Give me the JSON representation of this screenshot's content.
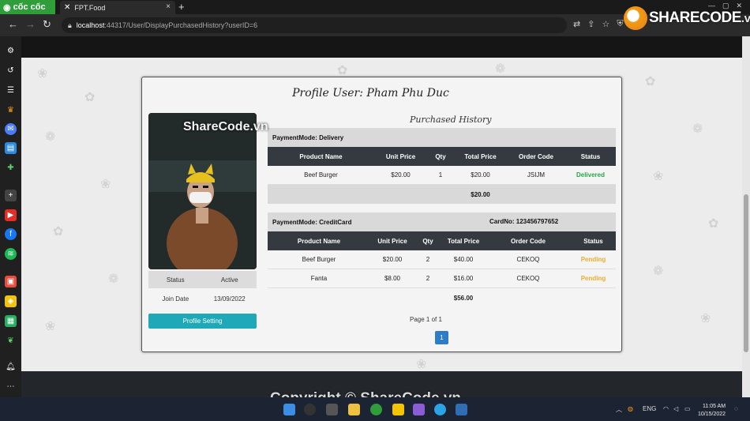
{
  "browser": {
    "brand": "cốc cốc",
    "tab_title": "FPT.Food",
    "url_host": "localhost",
    "url_path": ":44317/User/DisplayPurchasedHistory?userID=6"
  },
  "profile": {
    "title": "Profile User: Pham Phu Duc",
    "status_label": "Status",
    "status_value": "Active",
    "join_label": "Join Date",
    "join_value": "13/09/2022",
    "settings_button": "Profile Setting"
  },
  "history": {
    "title": "Purchased History",
    "orders": [
      {
        "payment_mode": "PaymentMode: Delivery",
        "card_no": "",
        "headers": [
          "Product Name",
          "Unit Price",
          "Qty",
          "Total Price",
          "Order Code",
          "Status"
        ],
        "items": [
          {
            "name": "Beef Burger",
            "unit_price": "$20.00",
            "qty": "1",
            "total": "$20.00",
            "code": "JSIJM",
            "status": "Delivered"
          }
        ],
        "total": "$20.00"
      },
      {
        "payment_mode": "PaymentMode: CreditCard",
        "card_no": "CardNo: 123456797652",
        "headers": [
          "Product Name",
          "Unit Price",
          "Qty",
          "Total Price",
          "Order Code",
          "Status"
        ],
        "items": [
          {
            "name": "Beef Burger",
            "unit_price": "$20.00",
            "qty": "2",
            "total": "$40.00",
            "code": "CEKOQ",
            "status": "Pending"
          },
          {
            "name": "Fanta",
            "unit_price": "$8.00",
            "qty": "2",
            "total": "$16.00",
            "code": "CEKOQ",
            "status": "Pending"
          }
        ],
        "total": "$56.00"
      }
    ],
    "pager_text": "Page 1 of 1",
    "current_page": "1"
  },
  "watermarks": {
    "top": "SHARECODE",
    "top_suffix": ".vn",
    "photo": "ShareCode.vn",
    "bottom": "Copyright © ShareCode.vn"
  },
  "taskbar": {
    "lang": "ENG",
    "time": "11:05 AM",
    "date": "10/15/2022"
  },
  "colors": {
    "accent_button": "#1ea8b8",
    "table_header": "#343a40",
    "delivered": "#28a745",
    "pending": "#f0ad2c",
    "pager": "#2e7bc6"
  }
}
